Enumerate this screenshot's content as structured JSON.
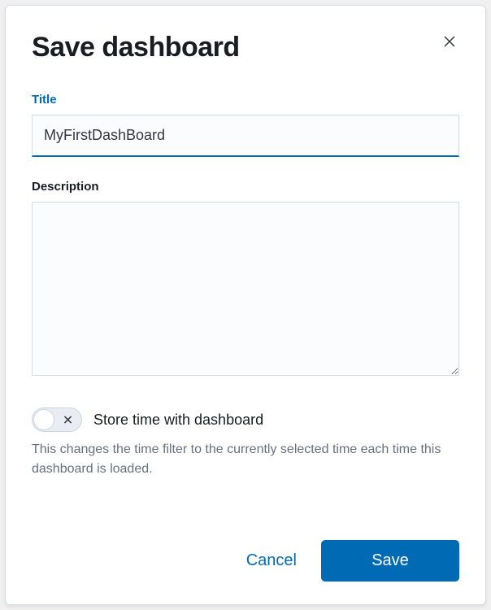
{
  "modal": {
    "title": "Save dashboard"
  },
  "form": {
    "title_label": "Title",
    "title_value": "MyFirstDashBoard",
    "description_label": "Description",
    "description_value": "",
    "toggle_label": "Store time with dashboard",
    "toggle_on": false,
    "help_text": "This changes the time filter to the currently selected time each time this dashboard is loaded."
  },
  "footer": {
    "cancel_label": "Cancel",
    "save_label": "Save"
  },
  "colors": {
    "accent": "#006bb4"
  }
}
